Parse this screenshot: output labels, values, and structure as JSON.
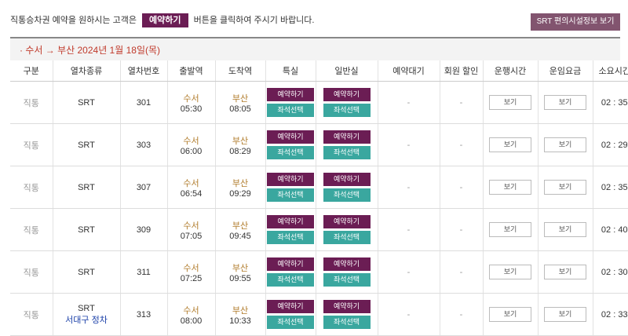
{
  "notice": {
    "before": "직통승차권 예약을 원하시는 고객은",
    "button": "예약하기",
    "after": "버튼을 클릭하여 주시기 바랍니다."
  },
  "info_button": "SRT 편의시설정보 보기",
  "route": "· 수서 → 부산 2024년 1월 18일(목)",
  "headers": [
    "구분",
    "열차종류",
    "열차번호",
    "출발역",
    "도착역",
    "특실",
    "일반실",
    "예약대기",
    "회원 할인",
    "운행시간",
    "운임요금",
    "소요시간"
  ],
  "buttons": {
    "reserve": "예약하기",
    "seat": "좌석선택",
    "view": "보기"
  },
  "rows": [
    {
      "type": "직통",
      "train": "SRT",
      "note": "",
      "number": "301",
      "dep_station": "수서",
      "dep_time": "05:30",
      "arr_station": "부산",
      "arr_time": "08:05",
      "waitlist": "-",
      "discount": "-",
      "duration": "02 : 35"
    },
    {
      "type": "직통",
      "train": "SRT",
      "note": "",
      "number": "303",
      "dep_station": "수서",
      "dep_time": "06:00",
      "arr_station": "부산",
      "arr_time": "08:29",
      "waitlist": "-",
      "discount": "-",
      "duration": "02 : 29"
    },
    {
      "type": "직통",
      "train": "SRT",
      "note": "",
      "number": "307",
      "dep_station": "수서",
      "dep_time": "06:54",
      "arr_station": "부산",
      "arr_time": "09:29",
      "waitlist": "-",
      "discount": "-",
      "duration": "02 : 35"
    },
    {
      "type": "직통",
      "train": "SRT",
      "note": "",
      "number": "309",
      "dep_station": "수서",
      "dep_time": "07:05",
      "arr_station": "부산",
      "arr_time": "09:45",
      "waitlist": "-",
      "discount": "-",
      "duration": "02 : 40"
    },
    {
      "type": "직통",
      "train": "SRT",
      "note": "",
      "number": "311",
      "dep_station": "수서",
      "dep_time": "07:25",
      "arr_station": "부산",
      "arr_time": "09:55",
      "waitlist": "-",
      "discount": "-",
      "duration": "02 : 30"
    },
    {
      "type": "직통",
      "train": "SRT",
      "note": "서대구 정차",
      "number": "313",
      "dep_station": "수서",
      "dep_time": "08:00",
      "arr_station": "부산",
      "arr_time": "10:33",
      "waitlist": "-",
      "discount": "-",
      "duration": "02 : 33"
    }
  ]
}
